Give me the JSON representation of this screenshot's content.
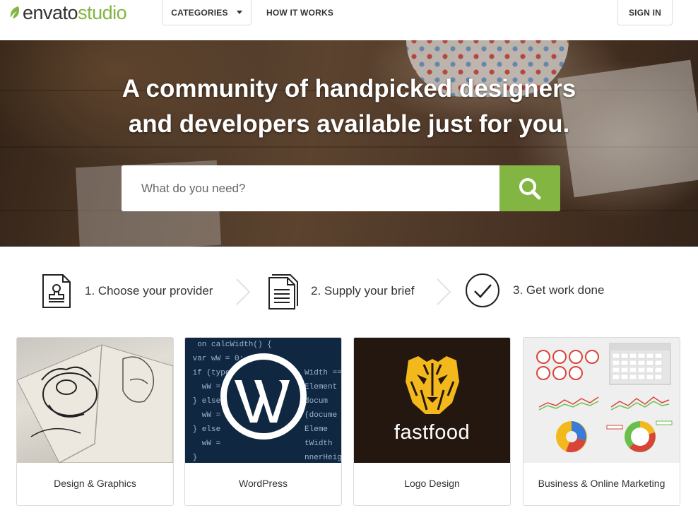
{
  "header": {
    "logo_brand": "envato",
    "logo_product": "studio",
    "nav_categories": "CATEGORIES",
    "nav_how_it_works": "HOW IT WORKS",
    "nav_sign_in": "SIGN IN"
  },
  "hero": {
    "title_line1": "A community of handpicked designers",
    "title_line2": "and developers available just for you.",
    "search_placeholder": "What do you need?"
  },
  "steps": [
    {
      "label": "1. Choose your provider",
      "icon": "stamp-document-icon"
    },
    {
      "label": "2. Supply your brief",
      "icon": "documents-icon"
    },
    {
      "label": "3. Get work done",
      "icon": "checkmark-circle-icon"
    }
  ],
  "cards": [
    {
      "caption": "Design & Graphics"
    },
    {
      "caption": "WordPress"
    },
    {
      "caption": "Logo Design",
      "logo_wordmark": "fastfood"
    },
    {
      "caption": "Business & Online Marketing"
    }
  ],
  "colors": {
    "accent": "#82b541",
    "hero_text": "#ffffff",
    "wp_background": "#0f2740",
    "logo_background": "#231710"
  }
}
